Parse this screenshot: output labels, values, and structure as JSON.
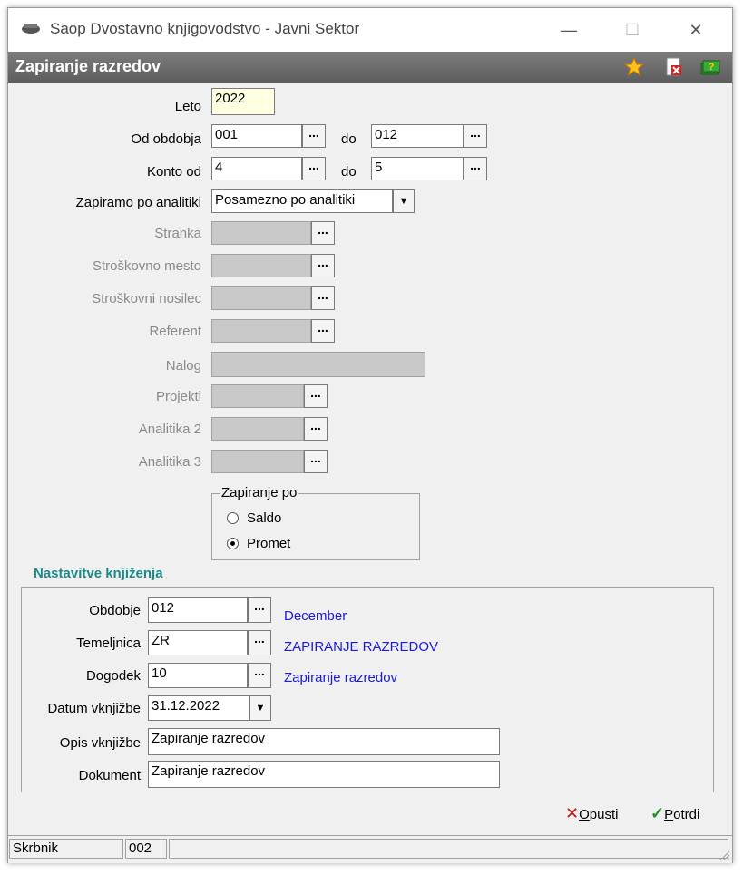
{
  "window": {
    "title": "Saop Dvostavno knjigovodstvo - Javni Sektor"
  },
  "header": {
    "title": "Zapiranje razredov",
    "icons": [
      "star-icon",
      "close-document-icon",
      "help-book-icon"
    ]
  },
  "form": {
    "leto": {
      "label": "Leto",
      "value": "2022"
    },
    "od_obdobja": {
      "label": "Od obdobja",
      "value": "001",
      "do_label": "do",
      "do_value": "012"
    },
    "konto_od": {
      "label": "Konto od",
      "value": "4",
      "do_label": "do",
      "do_value": "5"
    },
    "zapiramo": {
      "label": "Zapiramo po analitiki",
      "value": "Posamezno po analitiki"
    },
    "stranka": {
      "label": "Stranka"
    },
    "stroskovno_mesto": {
      "label": "Stroškovno mesto"
    },
    "stroskovni_nosilec": {
      "label": "Stroškovni nosilec"
    },
    "referent": {
      "label": "Referent"
    },
    "nalog": {
      "label": "Nalog"
    },
    "projekti": {
      "label": "Projekti"
    },
    "analitika2": {
      "label": "Analitika 2"
    },
    "analitika3": {
      "label": "Analitika 3"
    },
    "ellipsis": "...",
    "zapiranje_po": {
      "title": "Zapiranje po",
      "options": [
        "Saldo",
        "Promet"
      ],
      "selected": "Promet"
    }
  },
  "settings": {
    "title": "Nastavitve knjiženja",
    "obdobje": {
      "label": "Obdobje",
      "value": "012",
      "desc": "December"
    },
    "temeljnica": {
      "label": "Temeljnica",
      "value": "ZR",
      "desc": "ZAPIRANJE RAZREDOV"
    },
    "dogodek": {
      "label": "Dogodek",
      "value": "10",
      "desc": "Zapiranje razredov"
    },
    "datum": {
      "label": "Datum vknjižbe",
      "value": "31.12.2022"
    },
    "opis": {
      "label": "Opis vknjižbe",
      "value": "Zapiranje razredov"
    },
    "dokument": {
      "label": "Dokument",
      "value": "Zapiranje razredov"
    }
  },
  "buttons": {
    "opusti_prefix": "O",
    "opusti_rest": "pusti",
    "potrdi_prefix": "P",
    "potrdi_rest": "otrdi"
  },
  "status": {
    "label": "Skrbnik",
    "value": "002"
  }
}
